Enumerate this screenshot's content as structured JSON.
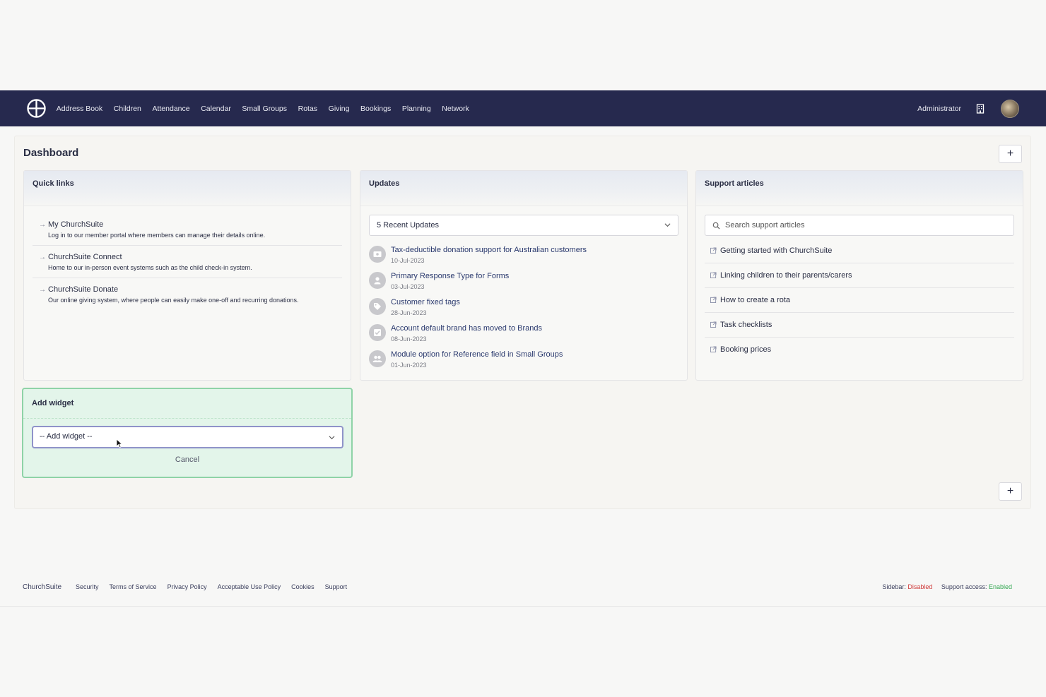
{
  "nav": {
    "items": [
      "Address Book",
      "Children",
      "Attendance",
      "Calendar",
      "Small Groups",
      "Rotas",
      "Giving",
      "Bookings",
      "Planning",
      "Network"
    ],
    "user_role": "Administrator",
    "icons": {
      "logo": "churchsuite-logo-icon",
      "building": "building-icon",
      "avatar": "avatar"
    }
  },
  "dashboard": {
    "title": "Dashboard",
    "add_button": "+"
  },
  "quick_links": {
    "title": "Quick links",
    "items": [
      {
        "title": "My ChurchSuite",
        "desc": "Log in to our member portal where members can manage their details online."
      },
      {
        "title": "ChurchSuite Connect",
        "desc": "Home to our in-person event systems such as the child check-in system."
      },
      {
        "title": "ChurchSuite Donate",
        "desc": "Our online giving system, where people can easily make one-off and recurring donations."
      }
    ]
  },
  "updates": {
    "title": "Updates",
    "filter_value": "5 Recent Updates",
    "items": [
      {
        "title": "Tax-deductible donation support for Australian customers",
        "date": "10-Jul-2023",
        "icon": "payment-icon"
      },
      {
        "title": "Primary Response Type for Forms",
        "date": "03-Jul-2023",
        "icon": "person-icon"
      },
      {
        "title": "Customer fixed tags",
        "date": "28-Jun-2023",
        "icon": "tag-icon"
      },
      {
        "title": "Account default brand has moved to Brands",
        "date": "08-Jun-2023",
        "icon": "checkbox-icon"
      },
      {
        "title": "Module option for Reference field in Small Groups",
        "date": "01-Jun-2023",
        "icon": "group-icon"
      }
    ]
  },
  "support": {
    "title": "Support articles",
    "search_placeholder": "Search support articles",
    "articles": [
      "Getting started with ChurchSuite",
      "Linking children to their parents/carers",
      "How to create a rota",
      "Task checklists",
      "Booking prices"
    ]
  },
  "add_widget": {
    "title": "Add widget",
    "select_value": "-- Add widget --",
    "cancel_label": "Cancel"
  },
  "footer": {
    "links": [
      "ChurchSuite",
      "Security",
      "Terms of Service",
      "Privacy Policy",
      "Acceptable Use Policy",
      "Cookies",
      "Support"
    ],
    "sidebar_label": "Sidebar:",
    "sidebar_value": "Disabled",
    "support_label": "Support access:",
    "support_value": "Enabled"
  },
  "colors": {
    "nav_bg": "#26294e",
    "accent_green": "#8fd3a7",
    "disabled_red": "#cf3b3b",
    "enabled_green": "#34a853"
  }
}
